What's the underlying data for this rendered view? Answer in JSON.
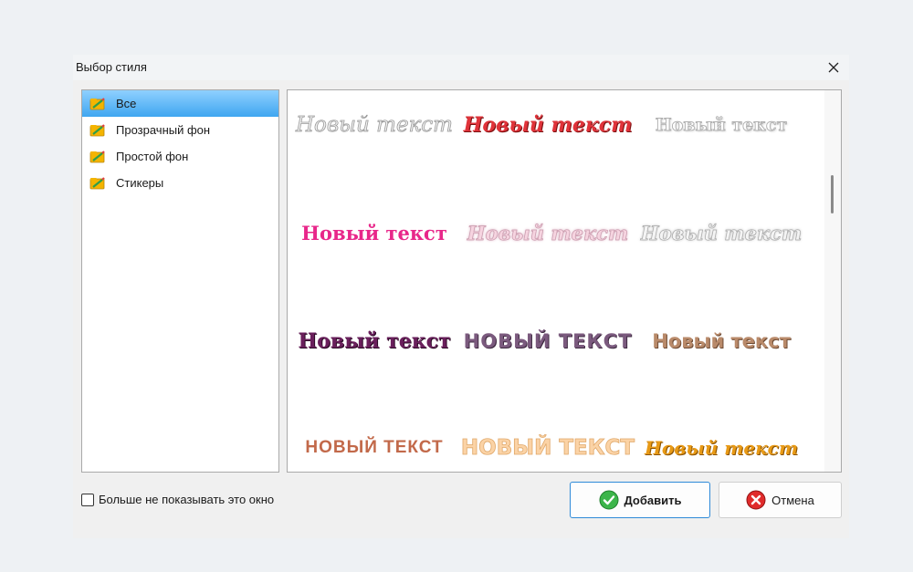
{
  "dialog": {
    "title": "Выбор стиля",
    "close_icon": "close-icon"
  },
  "categories": [
    {
      "label": "Все",
      "selected": true,
      "icon": "folder-style-icon"
    },
    {
      "label": "Прозрачный фон",
      "selected": false,
      "icon": "folder-style-icon"
    },
    {
      "label": "Простой фон",
      "selected": false,
      "icon": "folder-style-icon"
    },
    {
      "label": "Стикеры",
      "selected": false,
      "icon": "folder-style-icon"
    }
  ],
  "styles": [
    {
      "text": "Новый текст",
      "variant": "silver-script"
    },
    {
      "text": "Новый текст",
      "variant": "red-script"
    },
    {
      "text": "Новый текст",
      "variant": "grey-outline"
    },
    {
      "text": "Новый текст",
      "variant": "pink-script"
    },
    {
      "text": "Новый текст",
      "variant": "pink-glow"
    },
    {
      "text": "Новый текст",
      "variant": "silver-glow"
    },
    {
      "text": "Новый текст",
      "variant": "purple-gothic"
    },
    {
      "text": "НОВЫЙ ТЕКСТ",
      "variant": "purple-slab"
    },
    {
      "text": "Новый текст",
      "variant": "bronze-bold"
    },
    {
      "text": "НОВЫЙ ТЕКСТ",
      "variant": "rust-caps"
    },
    {
      "text": "НОВЫЙ ТЕКСТ",
      "variant": "peach-condensed"
    },
    {
      "text": "Новый текст",
      "variant": "orange-gothic"
    }
  ],
  "footer": {
    "dont_show_label": "Больше не показывать это окно",
    "dont_show_checked": false
  },
  "buttons": {
    "add_label": "Добавить",
    "add_icon": "check-icon",
    "cancel_label": "Отмена",
    "cancel_icon": "cancel-icon"
  },
  "colors": {
    "selection": "#3fa6f0",
    "add_border": "#2e8ad8",
    "add_icon": "#3cb54a",
    "cancel_icon": "#e02b2b"
  }
}
